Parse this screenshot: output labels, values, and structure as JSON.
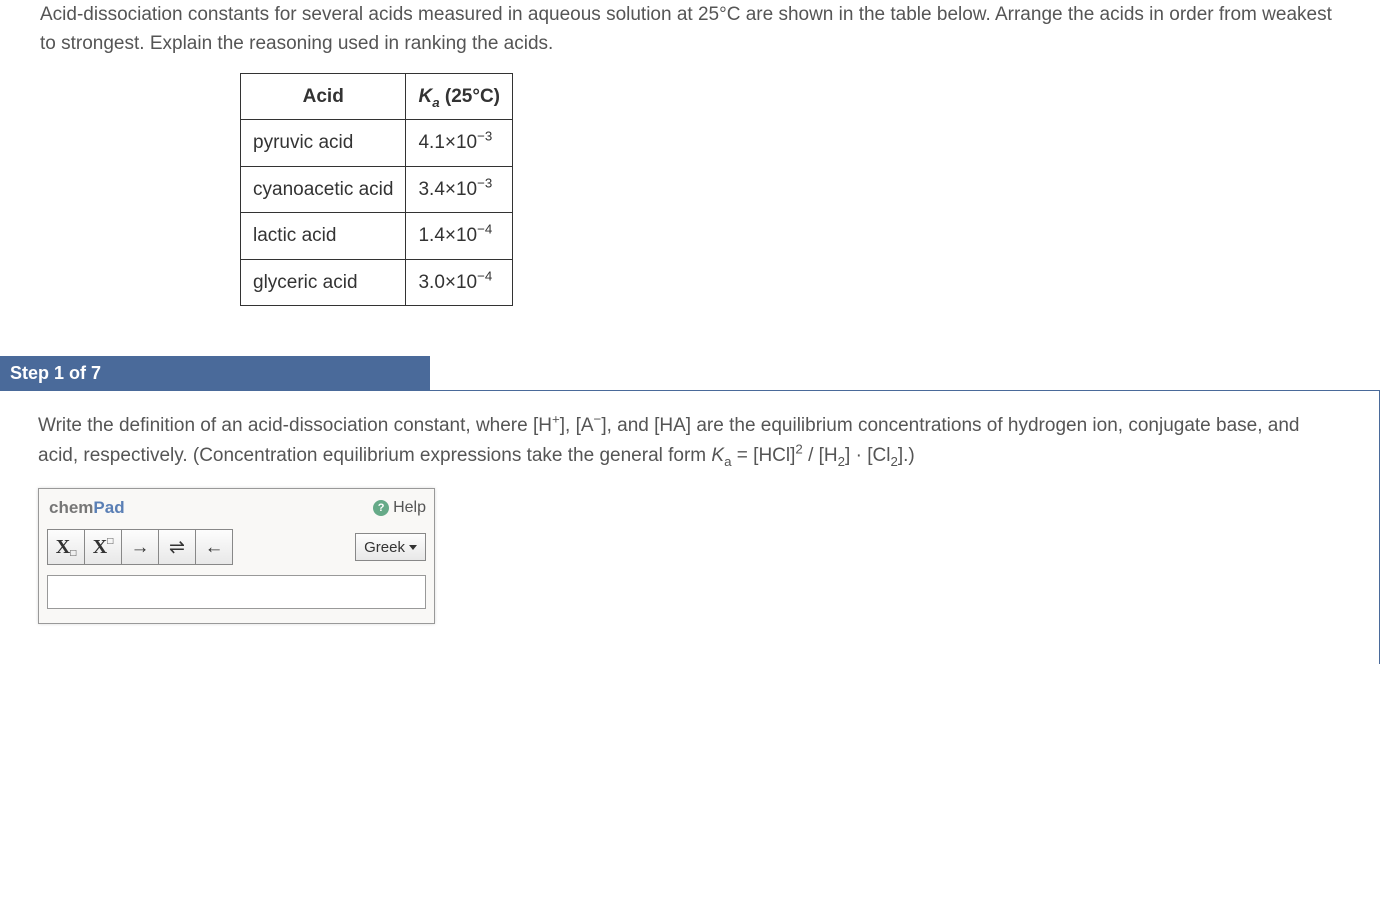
{
  "question": {
    "text": "Acid-dissociation constants for several acids measured in aqueous solution at 25°C are shown in the table below. Arrange the acids in order from weakest to strongest. Explain the reasoning used in ranking the acids."
  },
  "table": {
    "header_acid": "Acid",
    "header_ka_prefix": "K",
    "header_ka_sub": "a",
    "header_ka_suffix": " (25°C)",
    "rows": [
      {
        "acid": "pyruvic acid",
        "mantissa": "4.1",
        "exp": "−3"
      },
      {
        "acid": "cyanoacetic acid",
        "mantissa": "3.4",
        "exp": "−3"
      },
      {
        "acid": "lactic acid",
        "mantissa": "1.4",
        "exp": "−4"
      },
      {
        "acid": "glyceric acid",
        "mantissa": "3.0",
        "exp": "−4"
      }
    ]
  },
  "step": {
    "label": "Step 1 of 7",
    "instr_p1": "Write the definition of an acid-dissociation constant, where [H",
    "instr_sup1": "+",
    "instr_p2": "], [A",
    "instr_sup2": "−",
    "instr_p3": "], and [HA] are the equilibrium concentrations of hydrogen ion, conjugate base, and acid, respectively. (Concentration equilibrium expressions take the general form ",
    "formula_k": "K",
    "formula_ksub": "a",
    "formula_mid1": " = [HCl]",
    "formula_sup1": "2",
    "formula_mid2": " / [H",
    "formula_sub1": "2",
    "formula_mid3": "] · [Cl",
    "formula_sub2": "2",
    "formula_end": "].)"
  },
  "chempad": {
    "brand_a": "chem",
    "brand_b": "Pad",
    "help": "Help",
    "greek": "Greek",
    "input_value": ""
  },
  "icons": {
    "subscript": "subscript-icon",
    "superscript": "superscript-icon",
    "arrow_right": "arrow-right-icon",
    "equilibrium": "equilibrium-arrows-icon",
    "arrow_left": "arrow-left-icon",
    "help": "help-icon",
    "caret": "caret-down-icon"
  },
  "chart_data": {
    "type": "table",
    "title": "Acid-dissociation constants at 25°C",
    "columns": [
      "Acid",
      "Ka (25°C)"
    ],
    "rows": [
      [
        "pyruvic acid",
        0.0041
      ],
      [
        "cyanoacetic acid",
        0.0034
      ],
      [
        "lactic acid",
        0.00014
      ],
      [
        "glyceric acid",
        0.0003
      ]
    ]
  }
}
